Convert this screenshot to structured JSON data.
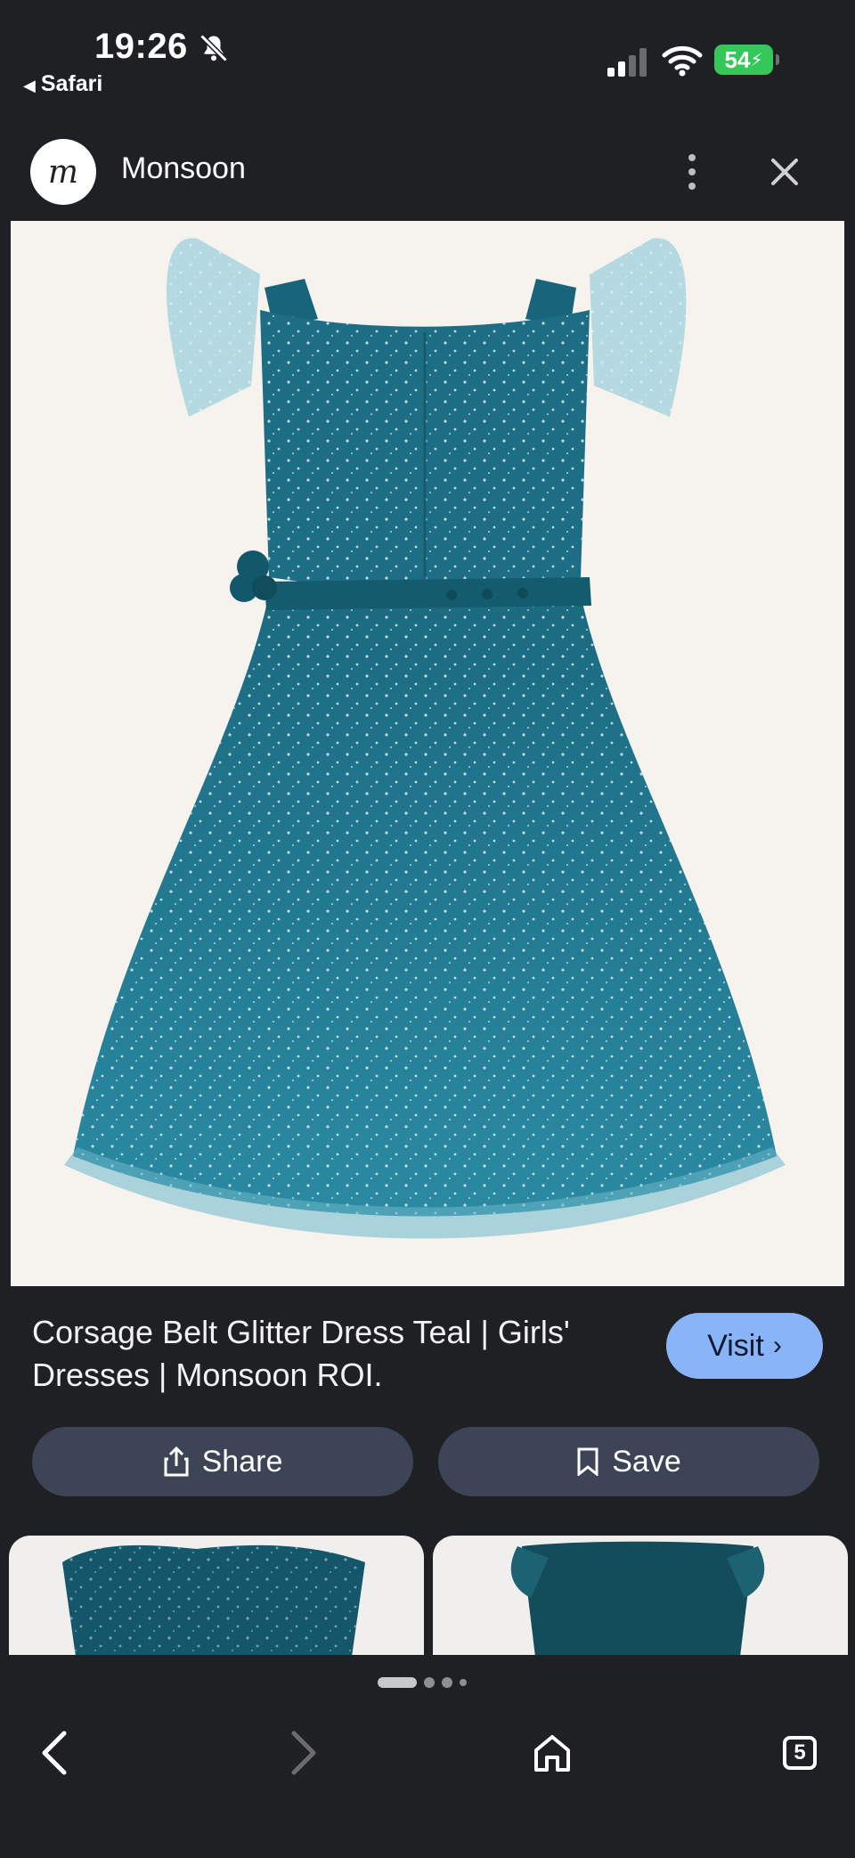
{
  "status_bar": {
    "time": "19:26",
    "back_app": "Safari",
    "battery": "54"
  },
  "header": {
    "site_logo": "m",
    "site_name": "Monsoon"
  },
  "result": {
    "title": "Corsage Belt Glitter Dress Teal | Girls' Dresses | Monsoon ROI.",
    "visit_label": "Visit",
    "share_label": "Share",
    "save_label": "Save"
  },
  "tabs": {
    "count": "5"
  },
  "icons": {
    "bell": "bell-slash-icon",
    "signal": "cellular-signal-icon",
    "wifi": "wifi-icon",
    "more": "more-vertical-icon",
    "close": "close-icon",
    "share": "share-icon",
    "save": "bookmark-icon",
    "back": "back-arrow-icon",
    "forward": "forward-arrow-icon",
    "home": "home-icon"
  },
  "colors": {
    "background": "#1f2023",
    "visit_button": "#8ab4f8",
    "pill_button": "#3c4455",
    "battery": "#34c759",
    "dress_teal": "#1e6f86"
  }
}
